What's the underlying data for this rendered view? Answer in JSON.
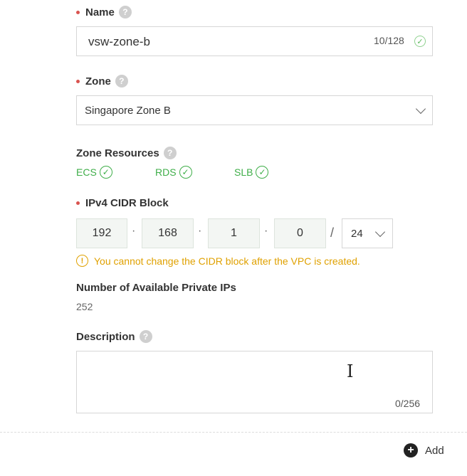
{
  "name": {
    "label": "Name",
    "value": "vsw-zone-b",
    "counter": "10/128"
  },
  "zone": {
    "label": "Zone",
    "selected": "Singapore Zone B"
  },
  "zone_resources": {
    "label": "Zone Resources",
    "items": [
      "ECS",
      "RDS",
      "SLB"
    ]
  },
  "cidr": {
    "label": "IPv4 CIDR Block",
    "octets": [
      "192",
      "168",
      "1",
      "0"
    ],
    "slash": "/",
    "mask": "24",
    "warning": "You cannot change the CIDR block after the VPC is created."
  },
  "available_ips": {
    "label": "Number of Available Private IPs",
    "value": "252"
  },
  "description": {
    "label": "Description",
    "value": "",
    "counter": "0/256"
  },
  "footer": {
    "add_label": "Add"
  },
  "colors": {
    "required_dot": "#d9534f",
    "success_green": "#3fae49",
    "warning_yellow": "#e0a100"
  }
}
